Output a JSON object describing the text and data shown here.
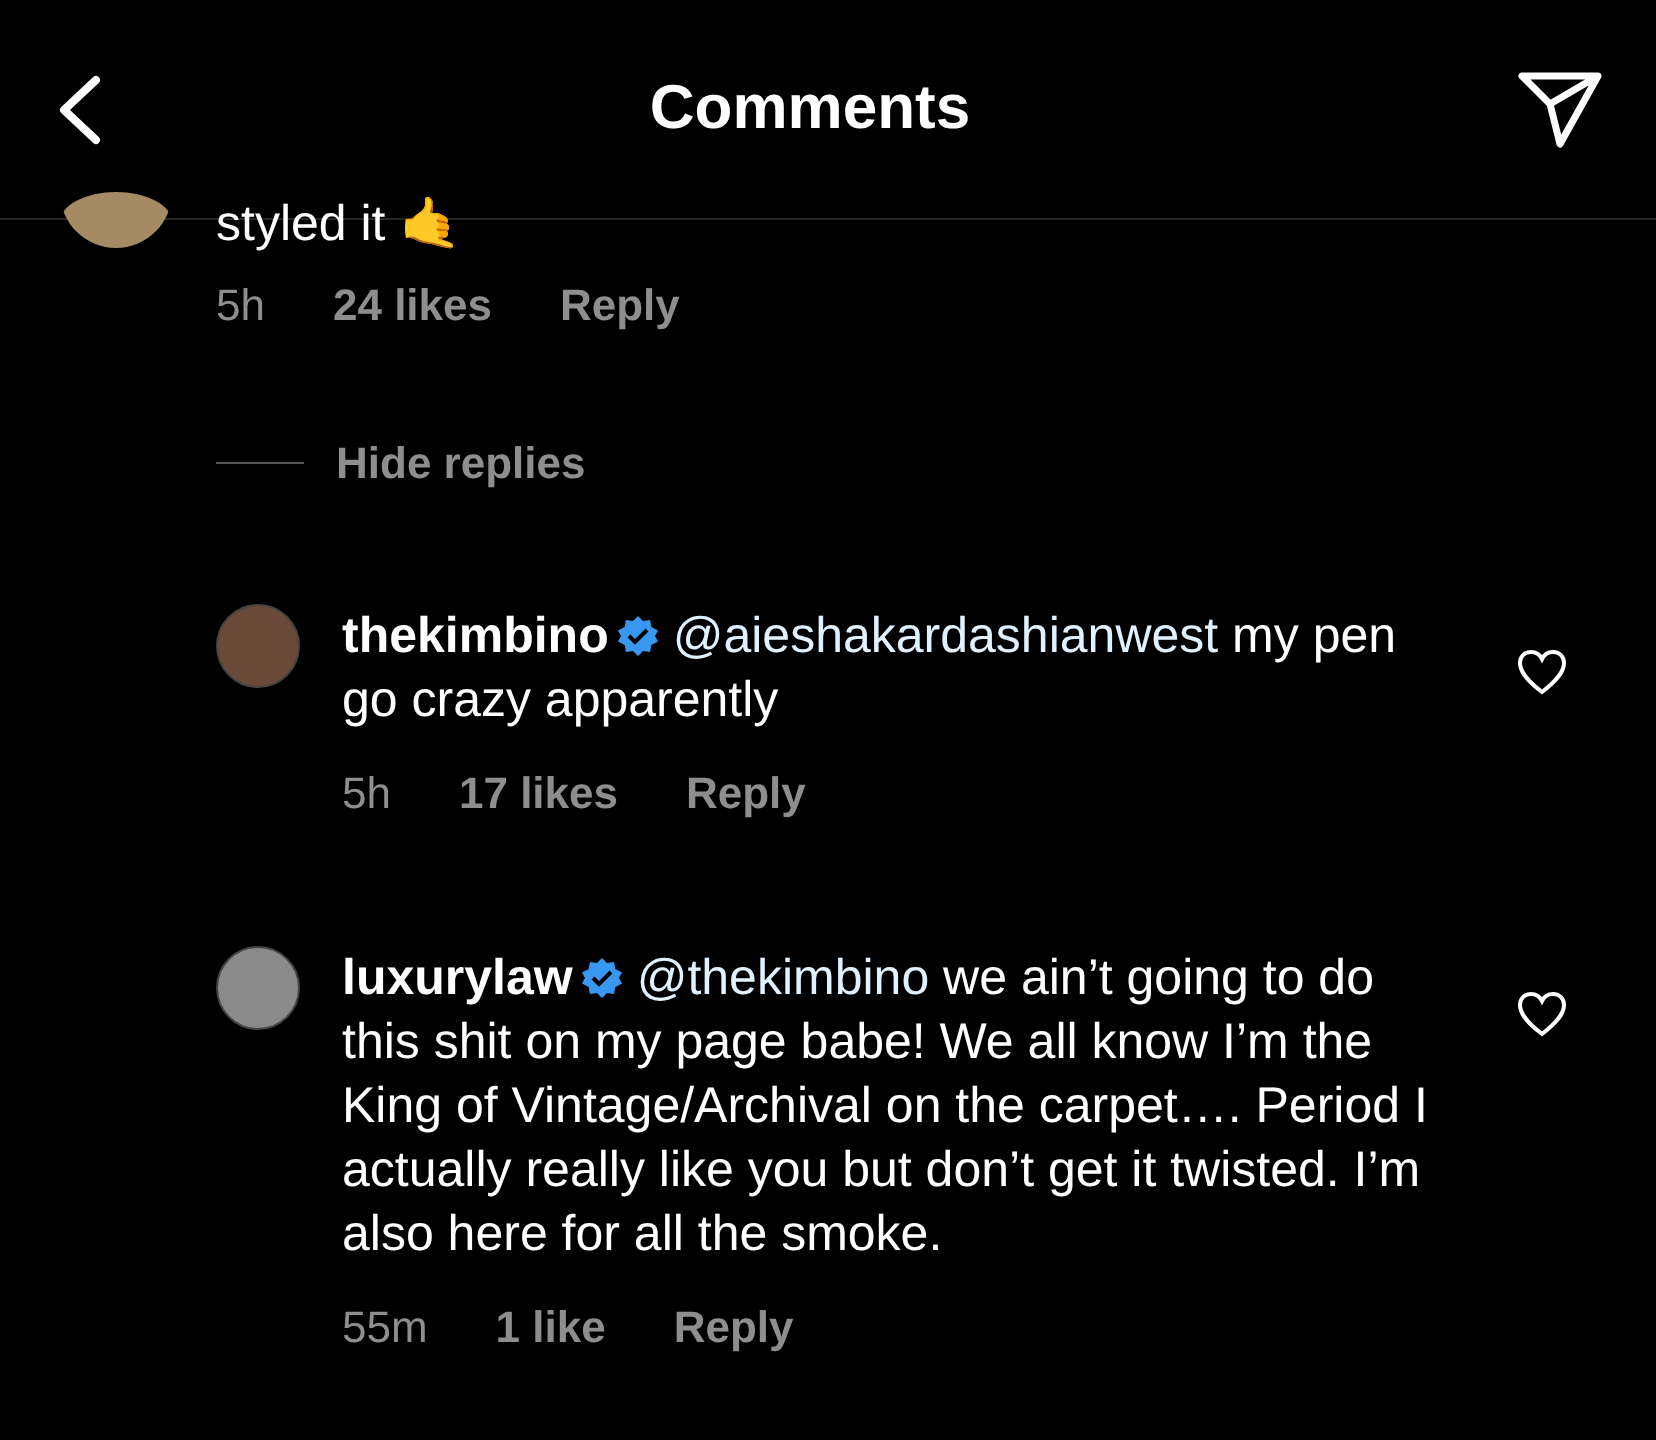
{
  "header": {
    "title": "Comments"
  },
  "top_comment": {
    "text": "styled it",
    "emoji": "🤙",
    "time": "5h",
    "likes": "24 likes",
    "reply": "Reply"
  },
  "hide_replies": "Hide replies",
  "replies": [
    {
      "username": "thekimbino",
      "verified": true,
      "mention": "@aieshakardashianwest",
      "text": "my pen go crazy apparently",
      "time": "5h",
      "likes": "17 likes",
      "reply": "Reply",
      "liked": false,
      "color": "#6b4a3a"
    },
    {
      "username": "luxurylaw",
      "verified": true,
      "mention": "@thekimbino",
      "text": "we ain’t going to do this shit on my page babe!  We all know I’m the King of Vintage/Archival on the carpet…. Period  I actually really like you but don’t get it twisted. I’m also here for all the smoke.",
      "time": "55m",
      "likes": "1 like",
      "reply": "Reply",
      "liked": false,
      "color": "#8a8a8a"
    }
  ]
}
